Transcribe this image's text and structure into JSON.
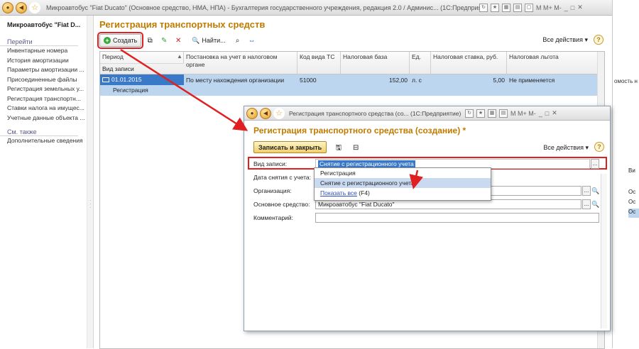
{
  "window": {
    "title": "Микроавтобус \"Fiat Ducato\" (Основное средство, НМА, НПА) - Бухгалтерия государственного учреждения, редакция 2.0 / Админис... (1С:Предприятие)",
    "tools": "M  M+  M-"
  },
  "left_panel": {
    "title": "Микроавтобус \"Fiat D...",
    "goto_header": "Перейти",
    "items": [
      "Инвентарные номера",
      "История амортизации",
      "Параметры амортизации ...",
      "Присоединенные файлы",
      "Регистрация земельных у...",
      "Регистрация транспортн...",
      "Ставки налога на имущес...",
      "Учетные данные объекта ..."
    ],
    "see_also_header": "См. также",
    "see_also_items": [
      "Дополнительные сведения"
    ]
  },
  "main": {
    "title": "Регистрация транспортных средств",
    "create_label": "Создать",
    "find_label": "Найти...",
    "all_actions": "Все действия",
    "help": "?",
    "columns": {
      "period": "Период",
      "record_type": "Вид записи",
      "registration": "Постановка на учет в налоговом органе",
      "vehicle_code": "Код вида ТС",
      "tax_base": "Налоговая база",
      "unit": "Ед.",
      "tax_rate": "Налоговая ставка, руб.",
      "tax_benefit": "Налоговая льгота"
    },
    "rows": [
      {
        "period": "01.01.2015",
        "record_type": "Регистрация",
        "registration": "По месту нахождения организации",
        "vehicle_code": "51000",
        "tax_base": "152,00",
        "unit": "л. с",
        "tax_rate": "5,00",
        "tax_benefit": "Не применяется"
      }
    ]
  },
  "dialog": {
    "window_title": "Регистрация транспортного средства (со... (1С:Предприятие)",
    "tools": "M  M+  M-",
    "heading": "Регистрация транспортного средства (создание) *",
    "save_close": "Записать и закрыть",
    "all_actions": "Все действия",
    "help": "?",
    "fields": {
      "record_type_label": "Вид записи:",
      "record_type_value": "Снятие с регистрационного учета",
      "removal_date_label": "Дата снятия с учета:",
      "organization_label": "Организация:",
      "asset_label": "Основное средство:",
      "asset_value": "Микроавтобус \"Fiat Ducato\"",
      "comment_label": "Комментарий:"
    },
    "dropdown": {
      "options": [
        "Регистрация",
        "Снятие с регистрационного учета"
      ],
      "show_all": "Показать все",
      "show_all_key": "(F4)"
    }
  },
  "right_strip": {
    "fragment": "омость н",
    "col_head": "Ви",
    "cells": [
      "Ос",
      "Ос",
      "Ос"
    ]
  },
  "colors": {
    "accent_title": "#c17a00",
    "selection": "#3a78c8",
    "highlight_red": "#e02020"
  }
}
